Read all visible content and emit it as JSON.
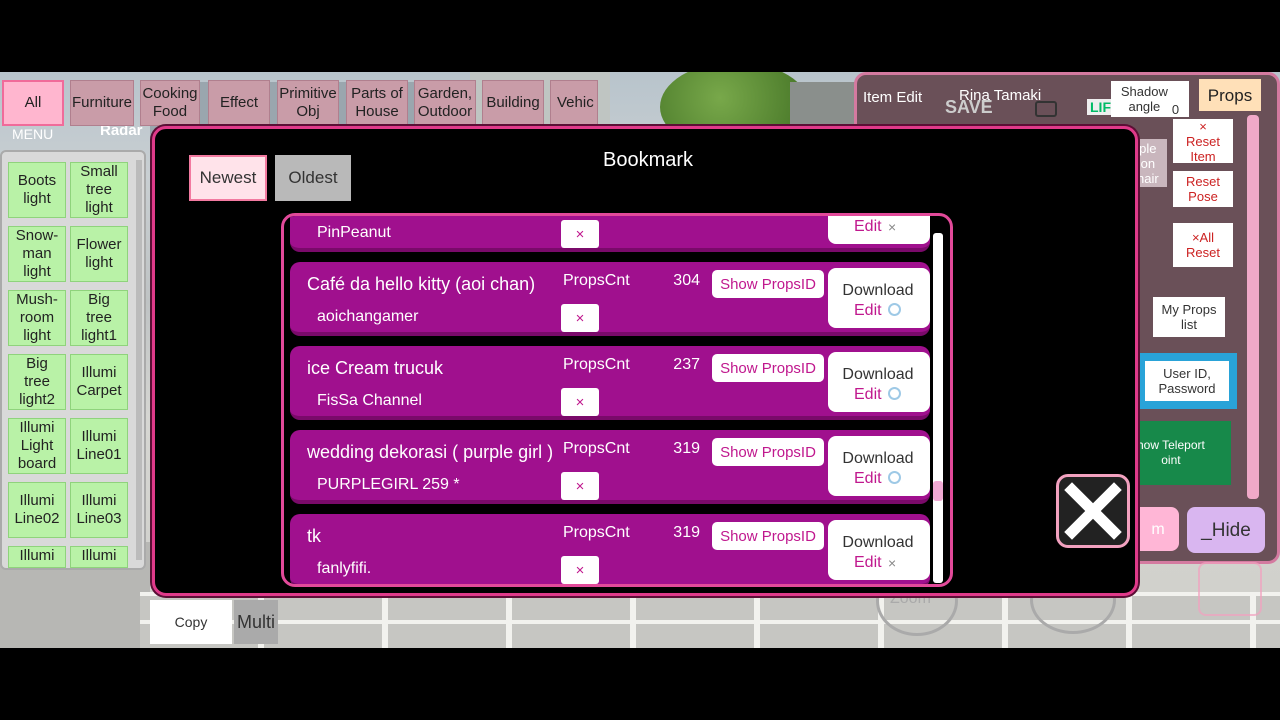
{
  "categories": [
    {
      "label": "All",
      "active": true
    },
    {
      "label": "Furniture"
    },
    {
      "label": "Cooking\nFood"
    },
    {
      "label": "Effect"
    },
    {
      "label": "Primitive\nObj"
    },
    {
      "label": "Parts of\nHouse"
    },
    {
      "label": "Garden,\nOutdoor"
    },
    {
      "label": "Building"
    },
    {
      "label": "Vehic"
    }
  ],
  "hud": {
    "menu": "MENU",
    "radar": "Radar",
    "item_edit": "Item Edit",
    "save": "SAVE",
    "character": "Rina Tamaki",
    "life": "LIFE",
    "zoom": "Zoom"
  },
  "items": [
    "Boots\nlight",
    "Small\ntree\nlight",
    "Snow-\nman\nlight",
    "Flower\nlight",
    "Mush-\nroom\nlight",
    "Big\ntree\nlight1",
    "Big\ntree\nlight2",
    "Illumi\nCarpet",
    "Illumi\nLight\nboard",
    "Illumi\nLine01",
    "Illumi\nLine02",
    "Illumi\nLine03",
    "Illumi",
    "Illumi"
  ],
  "right_panel": {
    "shadow_angle_label": "Shadow\nangle",
    "shadow_angle_value": "0",
    "props_tab": "Props",
    "reset_item": "×\nReset\nItem",
    "reset_pose": "Reset\nPose",
    "all_reset": "×All\nReset",
    "ple_on_hair": "ple\non\nhair",
    "my_props_list": "My Props\nlist",
    "user_id_password": "User ID,\nPassword",
    "show_teleport_point": "how Teleport\noint",
    "m_button": "m",
    "hide_button": "_Hide"
  },
  "bookmark": {
    "title": "Bookmark",
    "sort_newest": "Newest",
    "sort_oldest": "Oldest",
    "props_cnt_label": "PropsCnt",
    "show_props_id": "Show PropsID",
    "download": "Download",
    "edit": "Edit",
    "delete_symbol": "×",
    "rows": [
      {
        "name": "",
        "author": "PinPeanut",
        "count": "",
        "edit_state": "×"
      },
      {
        "name": "Café da hello kitty (aoi chan)",
        "author": "aoichangamer",
        "count": "304",
        "edit_state": "ring"
      },
      {
        "name": "ice Cream trucuk",
        "author": "FisSa Channel",
        "count": "237",
        "edit_state": "ring"
      },
      {
        "name": "wedding dekorasi ( purple girl )",
        "author": "PURPLEGIRL 259 *",
        "count": "319",
        "edit_state": "ring"
      },
      {
        "name": "tk",
        "author": "fanlyfifi.",
        "count": "319",
        "edit_state": "×"
      }
    ]
  },
  "bottom": {
    "copy": "Copy",
    "multi": "Multi"
  },
  "colors": {
    "row_bg": "#a0108e",
    "modal_border": "#e03a8a",
    "item_green": "#b9f2a7",
    "tab_pink": "#ffb6cf"
  }
}
